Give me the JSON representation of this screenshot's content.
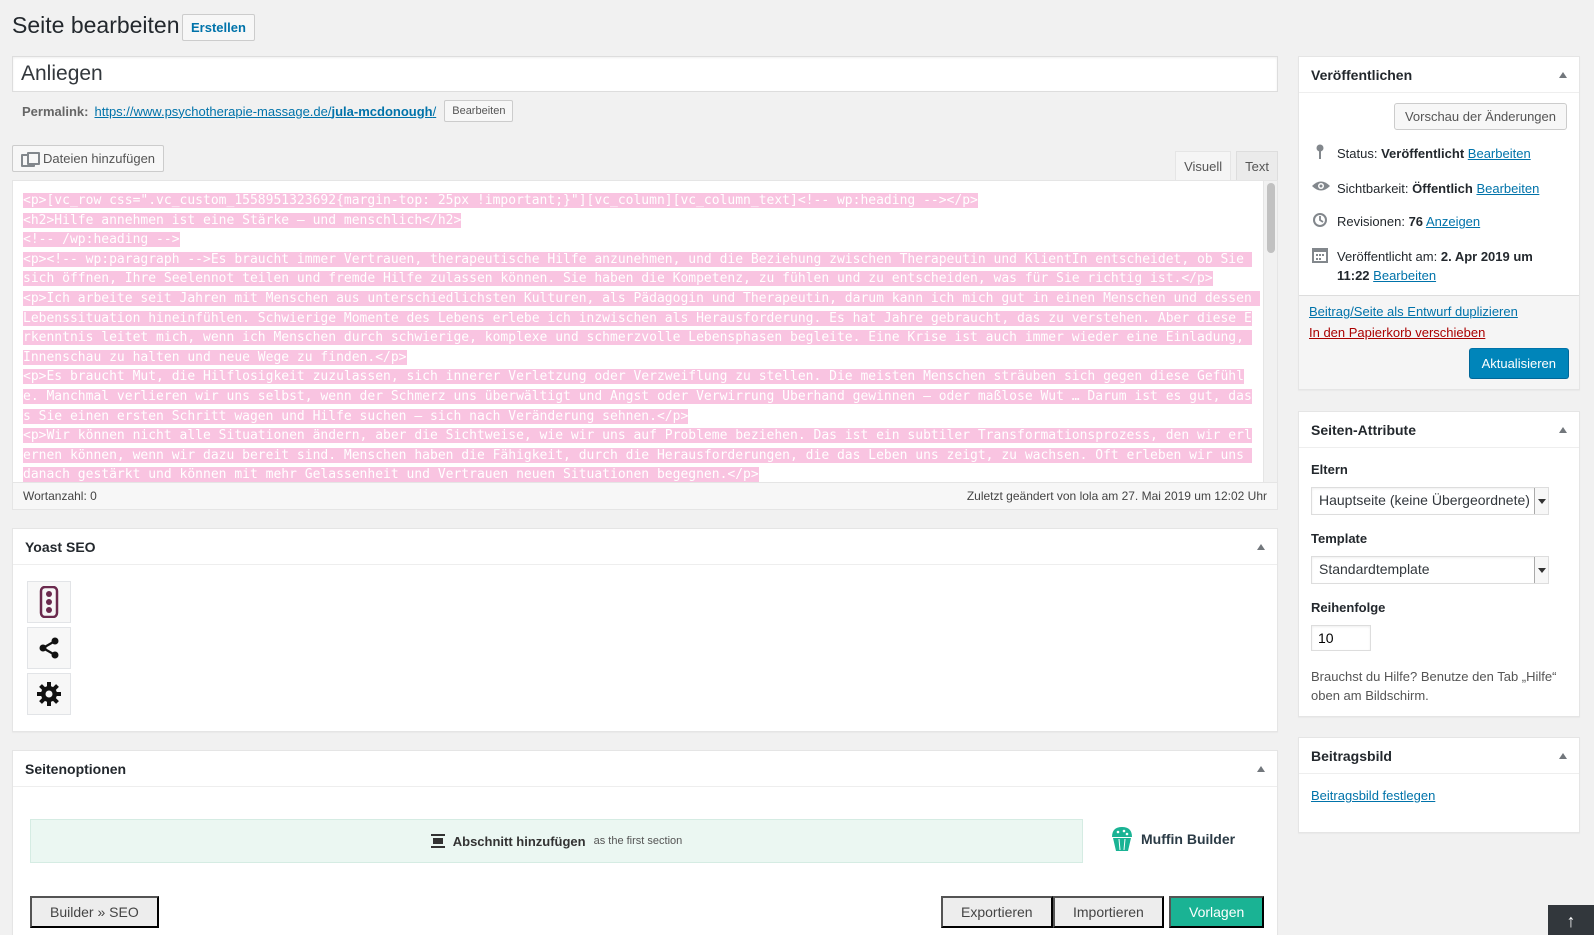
{
  "header": {
    "title": "Seite bearbeiten",
    "new_button": "Erstellen"
  },
  "post": {
    "title": "Anliegen",
    "permalink_label": "Permalink:",
    "permalink_base": "https://www.psychotherapie-massage.de/",
    "permalink_slug": "jula-mcdonough",
    "permalink_trail": "/",
    "permalink_edit": "Bearbeiten"
  },
  "editor": {
    "media_button": "Dateien hinzufügen",
    "tabs": [
      "Visuell",
      "Text"
    ],
    "active_tab": "Text",
    "content_lines": [
      "<p>[vc_row css=\".vc_custom_1558951323692{margin-top: 25px !important;}\"][vc_column][vc_column_text]<!-- wp:heading --></p>",
      "<h2>Hilfe annehmen ist eine Stärke – und menschlich</h2>",
      "<!-- /wp:heading -->",
      "<p><!-- wp:paragraph -->Es braucht immer Vertrauen, therapeutische Hilfe anzunehmen, und die Beziehung zwischen Therapeutin und KlientIn entscheidet, ob Sie sich öffnen, Ihre Seelennot teilen und fremde Hilfe zulassen können. Sie haben die Kompetenz, zu fühlen und zu entscheiden, was für Sie richtig ist.</p>",
      "<p>Ich arbeite seit Jahren mit Menschen aus unterschiedlichsten Kulturen, als Pädagogin und Therapeutin, darum kann ich mich gut in einen Menschen und dessen Lebenssituation hineinfühlen. Schwierige Momente des Lebens erlebe ich inzwischen als Herausforderung. Es hat Jahre gebraucht, das zu verstehen. Aber diese Erkenntnis leitet mich, wenn ich Menschen durch schwierige, komplexe und schmerzvolle Lebensphasen begleite. Eine Krise ist auch immer wieder eine Einladung, Innenschau zu halten und neue Wege zu finden.</p>",
      "<p>Es braucht Mut, die Hilflosigkeit zuzulassen, sich innerer Verletzung oder Verzweiflung zu stellen. Die meisten Menschen sträuben sich gegen diese Gefühle. Manchmal verlieren wir uns selbst, wenn der Schmerz uns überwältigt und Angst oder Verwirrung Überhand gewinnen – oder maßlose Wut … Darum ist es gut, dass Sie einen ersten Schritt wagen und Hilfe suchen – sich nach Veränderung sehnen.</p>",
      "<p>Wir können nicht alle Situationen ändern, aber die Sichtweise, wie wir uns auf Probleme beziehen. Das ist ein subtiler Transformationsprozess, den wir erlernen können, wenn wir dazu bereit sind. Menschen haben die Fähigkeit, durch die Herausforderungen, die das Leben uns zeigt, zu wachsen. Oft erleben wir uns danach gestärkt und können mit mehr Gelassenheit und Vertrauen neuen Situationen begegnen.</p>"
    ],
    "word_count": "Wortanzahl: 0",
    "last_edited": "Zuletzt geändert von lola am 27. Mai 2019 um 12:02 Uhr"
  },
  "yoast": {
    "title": "Yoast SEO",
    "tabs": [
      "traffic-light-icon",
      "share-icon",
      "gear-icon"
    ]
  },
  "seitenoptionen": {
    "title": "Seitenoptionen",
    "add_section": "Abschnitt hinzufügen",
    "add_section_sub": "as the first section",
    "logo_text": "Muffin Builder",
    "builder_seo": "Builder » SEO",
    "export": "Exportieren",
    "import": "Importieren",
    "templates": "Vorlagen",
    "accent": "#1ab394"
  },
  "publish": {
    "title": "Veröffentlichen",
    "preview": "Vorschau der Änderungen",
    "status_label": "Status:",
    "status_value": "Veröffentlicht",
    "visibility_label": "Sichtbarkeit:",
    "visibility_value": "Öffentlich",
    "revisions_label": "Revisionen:",
    "revisions_value": "76",
    "revisions_link": "Anzeigen",
    "published_label": "Veröffentlicht am:",
    "published_value": "2. Apr 2019 um 11:22",
    "edit_link": "Bearbeiten",
    "duplicate": "Beitrag/Seite als Entwurf duplizieren",
    "trash": "In den Papierkorb verschieben",
    "update": "Aktualisieren"
  },
  "attributes": {
    "title": "Seiten-Attribute",
    "parent_label": "Eltern",
    "parent_value": "Hauptseite (keine Übergeordnete)",
    "template_label": "Template",
    "template_value": "Standardtemplate",
    "order_label": "Reihenfolge",
    "order_value": "10",
    "help_text": "Brauchst du Hilfe? Benutze den Tab „Hilfe“ oben am Bildschirm."
  },
  "featured": {
    "title": "Beitragsbild",
    "set_link": "Beitragsbild festlegen"
  },
  "colors": {
    "link": "#0073aa",
    "primary": "#0085ba",
    "trash": "#a00",
    "highlight": "#f9c4e1"
  }
}
